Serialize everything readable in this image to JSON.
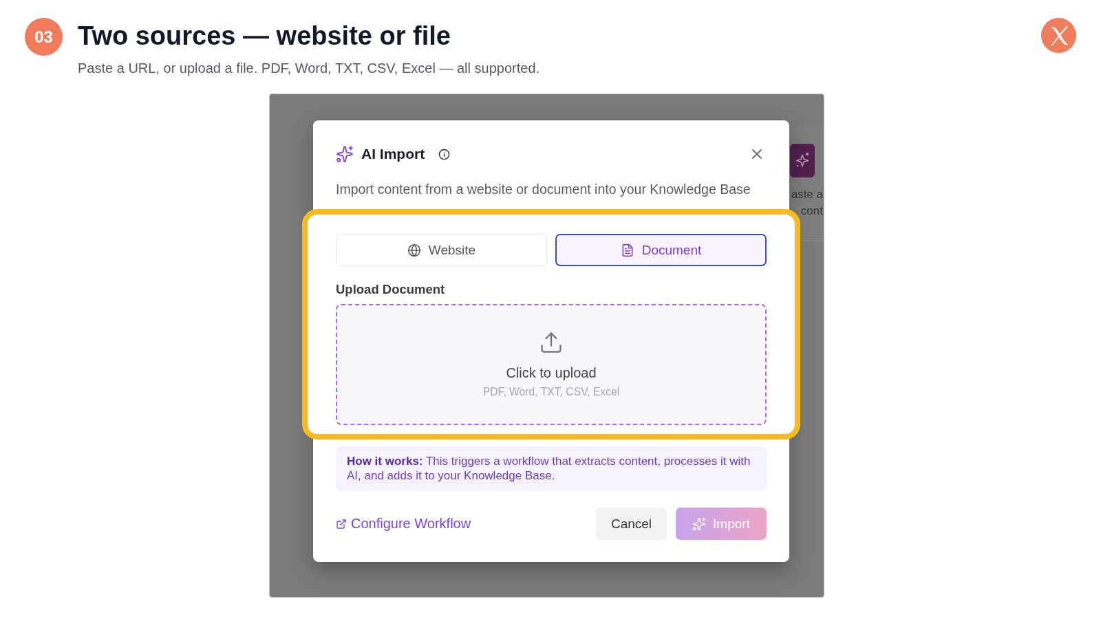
{
  "step": {
    "number": "03",
    "title": "Two sources — website or file",
    "subtitle": "Paste a URL, or upload a file. PDF, Word, TXT, CSV, Excel — all supported."
  },
  "screenshot": {
    "background": {
      "texts": [
        "aste a",
        "cont"
      ]
    },
    "dialog": {
      "title": "AI Import",
      "description": "Import content from a website or document into your Knowledge Base",
      "tabs": [
        {
          "label": "Website",
          "kind": "website",
          "selected": false
        },
        {
          "label": "Document",
          "kind": "document",
          "selected": true
        }
      ],
      "upload": {
        "label": "Upload Document",
        "prompt": "Click to upload",
        "formats": "PDF, Word, TXT, CSV, Excel"
      },
      "note": "**How it works:** This triggers a workflow that extracts content, processes it with AI, and adds it to your Knowledge Base.",
      "link": "Configure Workflow",
      "buttons": [
        {
          "label": "Cancel",
          "kind": "secondary",
          "disabled": false
        },
        {
          "label": "Import",
          "kind": "primary",
          "disabled": true
        }
      ]
    }
  }
}
